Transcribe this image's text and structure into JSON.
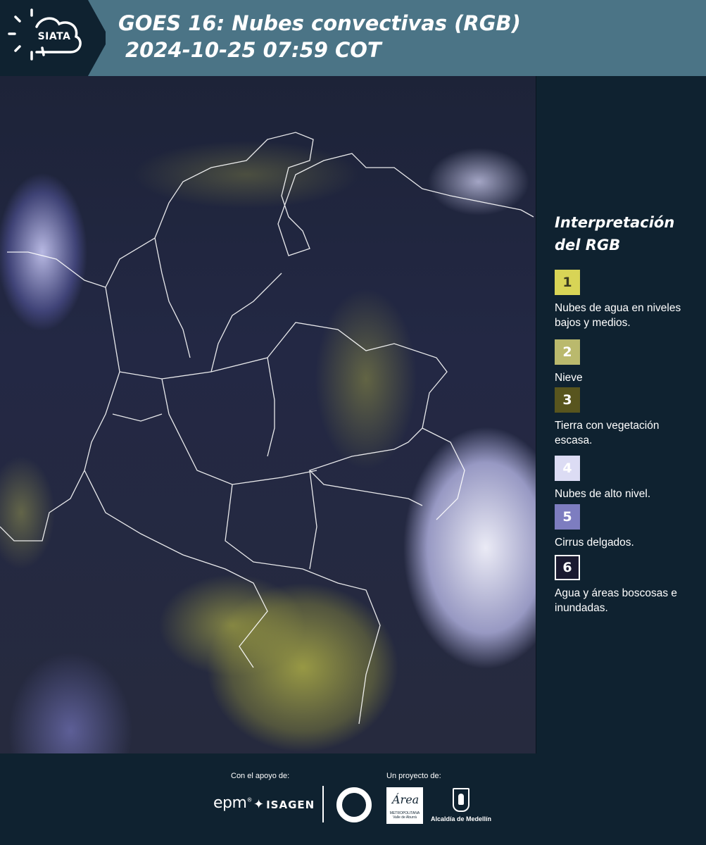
{
  "header": {
    "logo_text": "SIATA",
    "title_line1": "GOES 16: Nubes convectivas (RGB)",
    "title_line2": "2024-10-25 07:59 COT",
    "background": "#4b7486"
  },
  "legend": {
    "title": "Interpretación del RGB",
    "items": [
      {
        "number": "1",
        "label": "Nubes de agua en niveles bajos y medios.",
        "color": "#d8d456",
        "text_color": "#3a3a20"
      },
      {
        "number": "2",
        "label": "Nieve",
        "color": "#bab96d",
        "text_color": "#ffffff"
      },
      {
        "number": "3",
        "label": "Tierra con vegetación escasa.",
        "color": "#58551e",
        "text_color": "#ffffff"
      },
      {
        "number": "4",
        "label": "Nubes de alto nivel.",
        "color": "#dcdcf4",
        "text_color": "#ffffff"
      },
      {
        "number": "5",
        "label": "Cirrus delgados.",
        "color": "#7d7dc0",
        "text_color": "#ffffff"
      },
      {
        "number": "6",
        "label": "Agua y áreas boscosas e inundadas.",
        "color": "#1a1a30",
        "text_color": "#ffffff"
      }
    ]
  },
  "footer": {
    "support_label": "Con el apoyo de:",
    "project_label": "Un proyecto de:",
    "epm": "epm",
    "isagen": "ISAGEN",
    "area_word": "Área",
    "area_sub": "METROPOLITANA Valle de Aburrá",
    "medellin": "Alcaldía de Medellín"
  }
}
